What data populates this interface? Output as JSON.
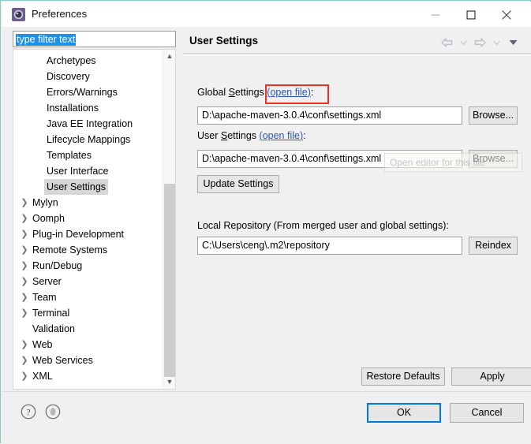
{
  "window": {
    "title": "Preferences",
    "icon": "gear-icon",
    "controls": {
      "minimize": "minimize-icon",
      "maximize": "maximize-icon",
      "close": "close-icon"
    }
  },
  "sidebar": {
    "filter": {
      "value": "type filter text",
      "placeholder": "type filter text",
      "selected": true
    },
    "items": [
      {
        "label": "Archetypes",
        "type": "leaf",
        "selected": false
      },
      {
        "label": "Discovery",
        "type": "leaf",
        "selected": false
      },
      {
        "label": "Errors/Warnings",
        "type": "leaf",
        "selected": false
      },
      {
        "label": "Installations",
        "type": "leaf",
        "selected": false
      },
      {
        "label": "Java EE Integration",
        "type": "leaf",
        "selected": false
      },
      {
        "label": "Lifecycle Mappings",
        "type": "leaf",
        "selected": false
      },
      {
        "label": "Templates",
        "type": "leaf",
        "selected": false
      },
      {
        "label": "User Interface",
        "type": "leaf",
        "selected": false
      },
      {
        "label": "User Settings",
        "type": "leaf",
        "selected": true
      },
      {
        "label": "Mylyn",
        "type": "parent",
        "selected": false
      },
      {
        "label": "Oomph",
        "type": "parent",
        "selected": false
      },
      {
        "label": "Plug-in Development",
        "type": "parent",
        "selected": false
      },
      {
        "label": "Remote Systems",
        "type": "parent",
        "selected": false
      },
      {
        "label": "Run/Debug",
        "type": "parent",
        "selected": false
      },
      {
        "label": "Server",
        "type": "parent",
        "selected": false
      },
      {
        "label": "Team",
        "type": "parent",
        "selected": false
      },
      {
        "label": "Terminal",
        "type": "parent",
        "selected": false
      },
      {
        "label": "Validation",
        "type": "leaf2",
        "selected": false
      },
      {
        "label": "Web",
        "type": "parent",
        "selected": false
      },
      {
        "label": "Web Services",
        "type": "parent",
        "selected": false
      },
      {
        "label": "XML",
        "type": "parent",
        "selected": false
      }
    ],
    "scrollbar": {
      "up_icon": "chevron-up-icon",
      "down_icon": "chevron-down-icon"
    }
  },
  "main": {
    "title": "User Settings",
    "nav": {
      "back_icon": "arrow-left-icon",
      "back_menu_icon": "chevron-down-icon",
      "forward_icon": "arrow-right-icon",
      "forward_menu_icon": "chevron-down-icon",
      "view_menu_icon": "chevron-down-filled-icon"
    },
    "global_settings": {
      "label_prefix": "Global ",
      "label_mnemonic": "S",
      "label_rest": "ettings ",
      "link": "open file",
      "label_suffix": ":",
      "value": "D:\\apache-maven-3.0.4\\conf\\settings.xml",
      "browse_label": "Browse..."
    },
    "user_settings": {
      "label_prefix": "User ",
      "label_mnemonic": "S",
      "label_rest": "ettings ",
      "link": "open file",
      "label_suffix": ":",
      "value": "D:\\apache-maven-3.0.4\\conf\\settings.xml",
      "browse_label": "Browse..."
    },
    "update_settings_label": "Update Settings",
    "local_repository": {
      "label": "Local Repository (From merged user and global settings):",
      "value": "C:\\Users\\ceng\\.m2\\repository",
      "reindex_label": "Reindex"
    },
    "tooltip": {
      "text": "Open editor for this file",
      "fading": true
    },
    "restore_defaults_label": "Restore Defaults",
    "apply_label": "Apply"
  },
  "footer": {
    "help_icon": "help-icon",
    "restore_icon": "restore-window-icon",
    "ok_label": "OK",
    "cancel_label": "Cancel"
  },
  "annotation": {
    "type": "highlight-rectangle",
    "color": "#ee3124",
    "targets": "open file link of Global Settings"
  },
  "colors": {
    "window_border": "#8fc8c8",
    "dialog_bg": "#f0f0f0",
    "selection_blue": "#1e90e8",
    "focus_blue": "#0078d7",
    "link": "#2a57b5",
    "annotation_red": "#ee3124",
    "tree_selected_bg": "#d6d6d6"
  }
}
